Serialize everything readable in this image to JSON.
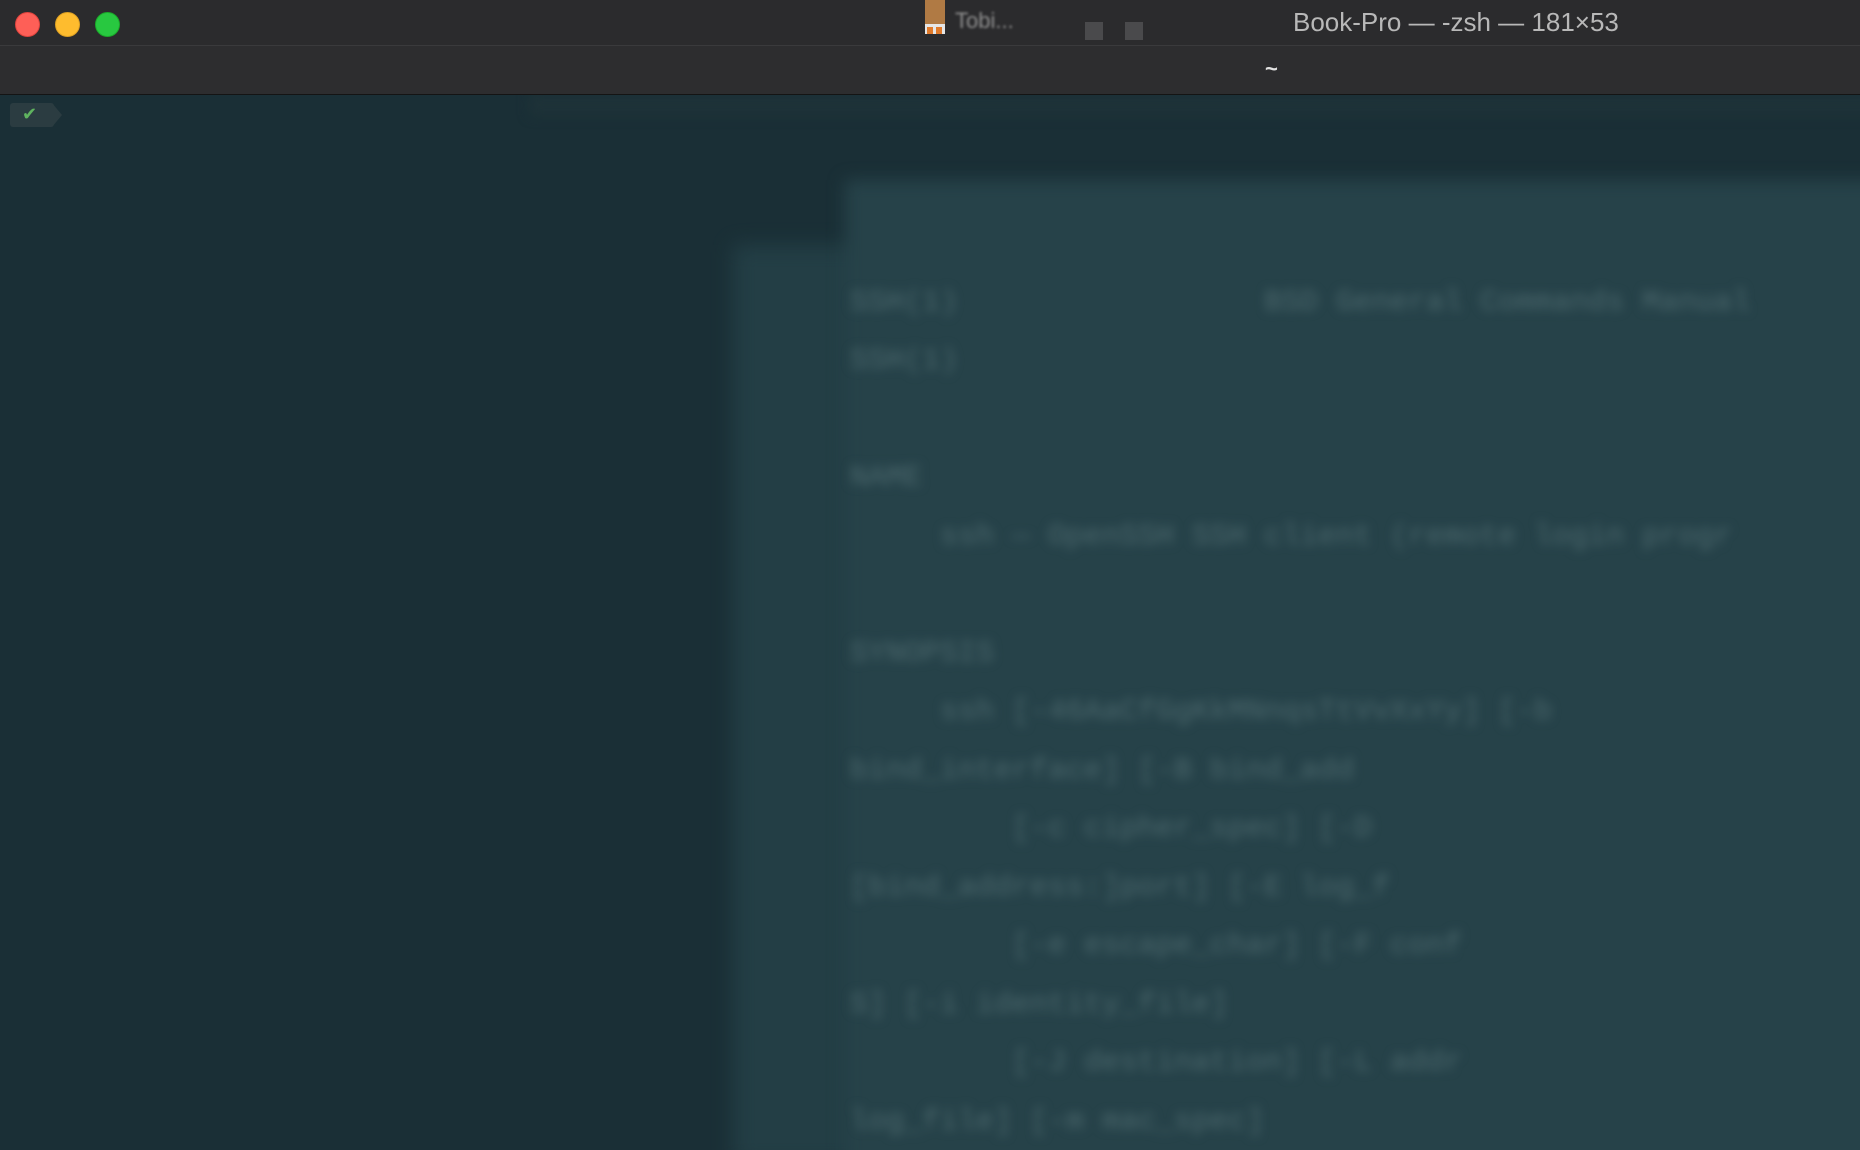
{
  "window": {
    "title": "Book-Pro — -zsh — 181×53",
    "background_tab_label": "Tobi..."
  },
  "tabbar": {
    "active_tab_label": "~"
  },
  "prompt": {
    "status_icon": "check-icon",
    "status_glyph": "✔"
  },
  "colors": {
    "terminal_bg": "#1a2f36",
    "titlebar_bg": "#2b2b2d",
    "close": "#fe5f57",
    "minimize": "#febc2e",
    "zoom": "#28c840",
    "prompt_ok": "#5fb35f"
  }
}
